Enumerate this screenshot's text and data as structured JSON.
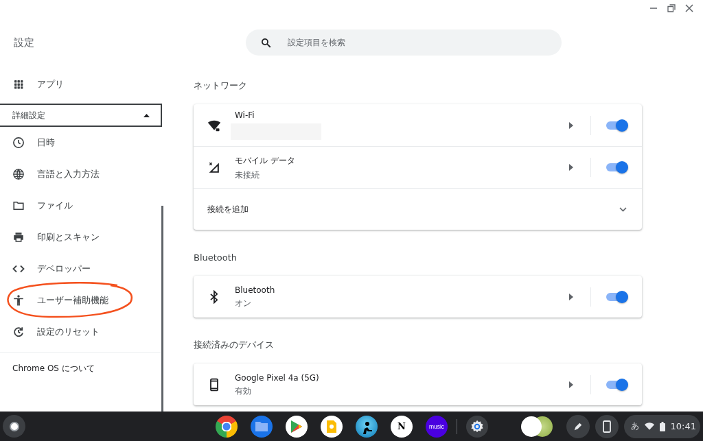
{
  "app_title": "設定",
  "search": {
    "placeholder": "設定項目を検索"
  },
  "sidebar": {
    "items": [
      {
        "kind": "item",
        "label": "アプリ",
        "circled": false
      },
      {
        "kind": "group",
        "label": "詳細設定",
        "expanded": true
      },
      {
        "kind": "item",
        "label": "日時",
        "circled": false
      },
      {
        "kind": "item",
        "label": "言語と入力方法",
        "circled": false
      },
      {
        "kind": "item",
        "label": "ファイル",
        "circled": false
      },
      {
        "kind": "item",
        "label": "印刷とスキャン",
        "circled": false
      },
      {
        "kind": "item",
        "label": "デベロッパー",
        "circled": false
      },
      {
        "kind": "item",
        "label": "ユーザー補助機能",
        "circled": true
      },
      {
        "kind": "item",
        "label": "設定のリセット",
        "circled": false
      },
      {
        "kind": "about",
        "label": "Chrome OS について"
      }
    ]
  },
  "sections": [
    {
      "title": "ネットワーク",
      "rows": [
        {
          "kind": "toggle",
          "name": "Wi-Fi",
          "redacted": true,
          "on": true
        },
        {
          "kind": "toggle",
          "name": "モバイル データ",
          "status": "未接続",
          "on": true
        },
        {
          "kind": "expand",
          "name": "接続を追加"
        }
      ]
    },
    {
      "title": "Bluetooth",
      "rows": [
        {
          "kind": "toggle",
          "name": "Bluetooth",
          "status": "オン",
          "on": true
        }
      ]
    },
    {
      "title": "接続済みのデバイス",
      "rows": [
        {
          "kind": "toggle",
          "name": "Google Pixel 4a (5G)",
          "status": "有効",
          "on": true
        }
      ]
    }
  ],
  "shelf": [
    {
      "kind": "chrome"
    },
    {
      "kind": "files"
    },
    {
      "kind": "play"
    },
    {
      "kind": "keep"
    },
    {
      "kind": "kindle"
    },
    {
      "kind": "notion",
      "text": "N"
    },
    {
      "kind": "music",
      "text": "music"
    },
    {
      "kind": "separator"
    },
    {
      "kind": "settings"
    }
  ],
  "status_area": {
    "ime": "あ",
    "time": "10:41"
  }
}
